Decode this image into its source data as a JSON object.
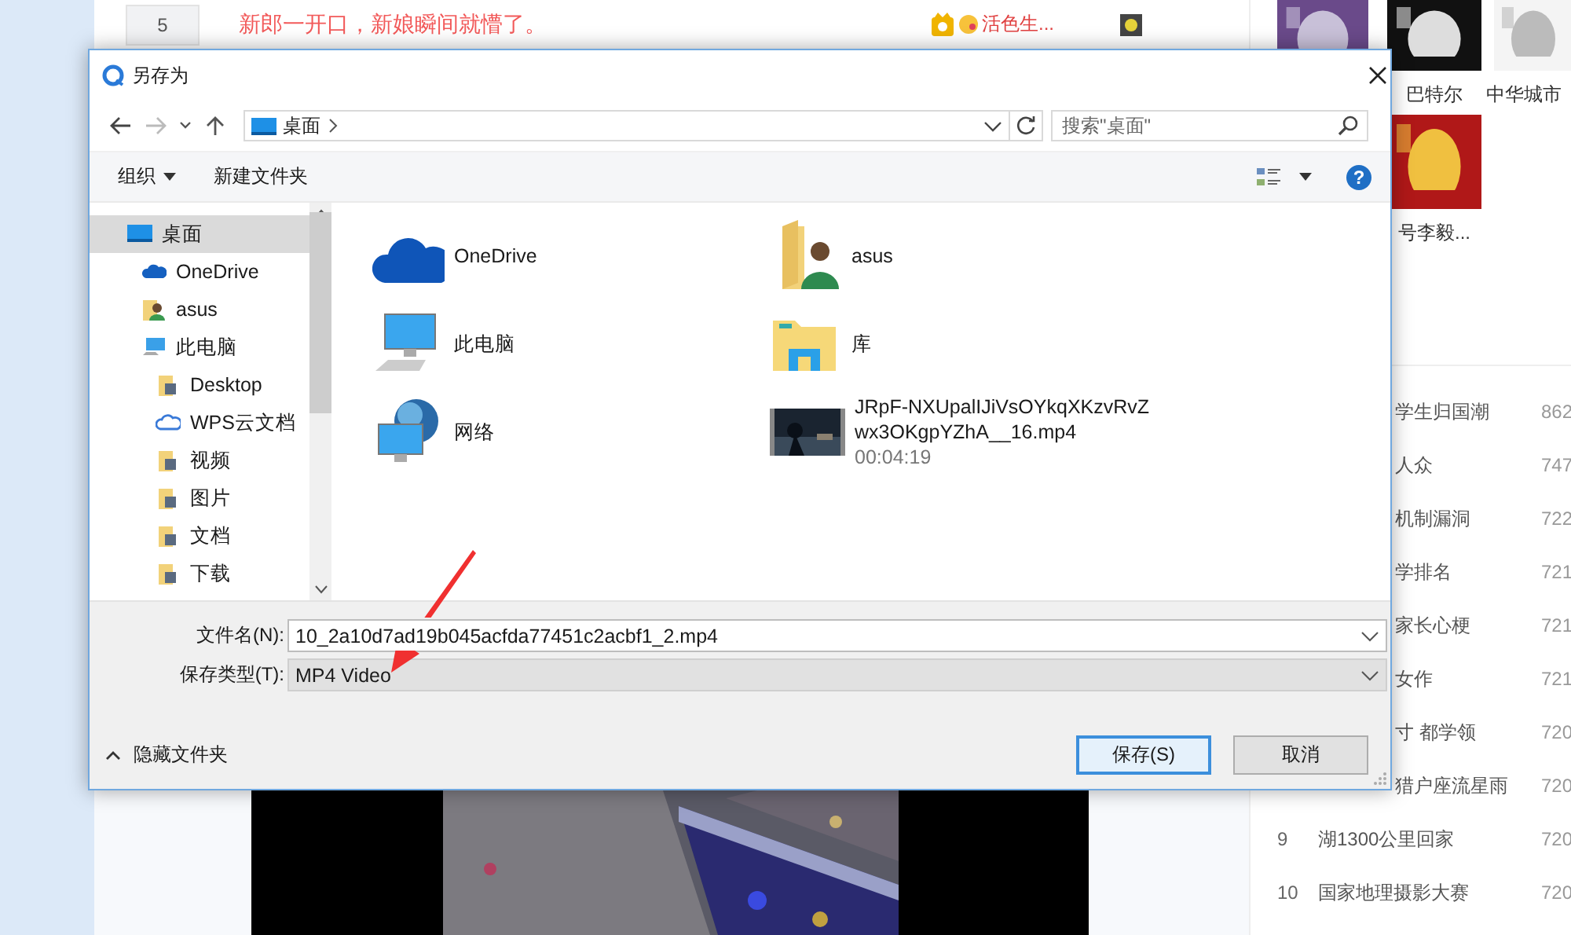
{
  "page": {
    "top_row": {
      "rank": "5",
      "title": "新郎一开口，新娘瞬间就懵了。",
      "tag": "活色生..."
    },
    "video": {
      "kind": "picture"
    },
    "thumbs": [
      {
        "kind": "picture"
      },
      {
        "kind": "picture",
        "caption": "巴特尔"
      },
      {
        "kind": "picture",
        "caption": "中华城市"
      },
      {
        "kind": "picture",
        "caption": "号李毅..."
      }
    ],
    "hot_list": [
      {
        "title": "学生归国潮",
        "count": "862"
      },
      {
        "title": "人众",
        "count": "747"
      },
      {
        "title": "机制漏洞",
        "count": "722"
      },
      {
        "title": "学排名",
        "count": "721"
      },
      {
        "title": "家长心梗",
        "count": "721"
      },
      {
        "title": "女作",
        "count": "721"
      },
      {
        "title": "寸 都学领",
        "count": "720"
      },
      {
        "title": "猎户座流星雨",
        "count": "720"
      },
      {
        "rank": "9",
        "title": "湖1300公里回家",
        "count": "720"
      },
      {
        "rank": "10",
        "title": "国家地理摄影大赛",
        "count": "720"
      }
    ]
  },
  "dialog": {
    "title": "另存为",
    "address": {
      "location": "桌面"
    },
    "search": {
      "placeholder": "搜索\"桌面\""
    },
    "toolbar": {
      "organize": "组织",
      "new_folder": "新建文件夹",
      "help": "?"
    },
    "nav_tree": [
      {
        "label": "桌面",
        "selected": true,
        "children": [
          {
            "label": "OneDrive",
            "selected": false
          },
          {
            "label": "asus",
            "selected": false
          },
          {
            "label": "此电脑",
            "selected": false,
            "children": [
              {
                "label": "Desktop",
                "selected": false
              },
              {
                "label": "WPS云文档",
                "selected": false
              },
              {
                "label": "视频",
                "selected": false
              },
              {
                "label": "图片",
                "selected": false
              },
              {
                "label": "文档",
                "selected": false
              },
              {
                "label": "下载",
                "selected": false
              }
            ]
          }
        ]
      }
    ],
    "items": [
      {
        "kind": "cloud",
        "name": "OneDrive"
      },
      {
        "kind": "pc",
        "name": "此电脑"
      },
      {
        "kind": "network",
        "name": "网络"
      },
      {
        "kind": "user",
        "name": "asus"
      },
      {
        "kind": "library",
        "name": "库"
      },
      {
        "kind": "video",
        "name_lines": [
          "JRpF-NXUpalIJiVsOYkqXKzvRvZ",
          "wx3OKgpYZhA__16.mp4"
        ],
        "duration": "00:04:19"
      }
    ],
    "file_name": {
      "label": "文件名(N):",
      "value": "10_2a10d7ad19b045acfda77451c2acbf1_2.mp4"
    },
    "file_type": {
      "label": "保存类型(T):",
      "value": "MP4 Video"
    },
    "hide_folders": "隐藏文件夹",
    "buttons": [
      {
        "label": "保存(S)",
        "primary": true
      },
      {
        "label": "取消",
        "primary": false
      }
    ]
  },
  "annotations": [
    {
      "kind": "arrow"
    }
  ]
}
